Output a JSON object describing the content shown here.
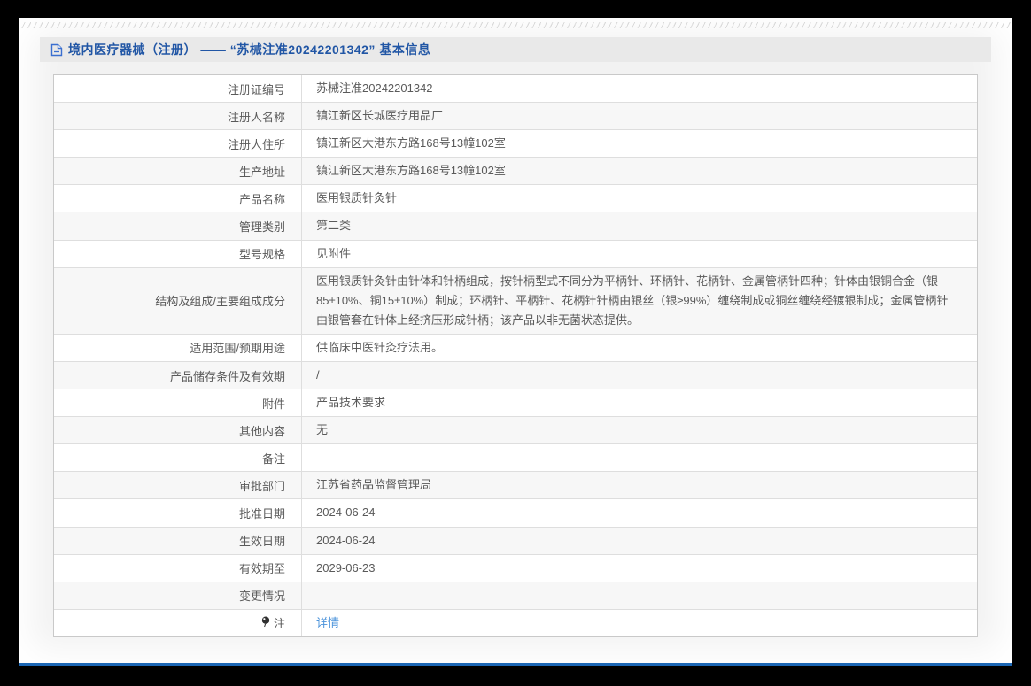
{
  "header": {
    "title": "境内医疗器械（注册） —— “苏械注准20242201342” 基本信息"
  },
  "colors": {
    "frame": "#000000",
    "accent_line": "#1b66b4",
    "title_text": "#2156a5",
    "link_text": "#4d94db"
  },
  "table": {
    "rows": [
      {
        "label": "注册证编号",
        "value": "苏械注准20242201342"
      },
      {
        "label": "注册人名称",
        "value": "镇江新区长城医疗用品厂"
      },
      {
        "label": "注册人住所",
        "value": "镇江新区大港东方路168号13幢102室"
      },
      {
        "label": "生产地址",
        "value": "镇江新区大港东方路168号13幢102室"
      },
      {
        "label": "产品名称",
        "value": "医用银质针灸针"
      },
      {
        "label": "管理类别",
        "value": "第二类"
      },
      {
        "label": "型号规格",
        "value": "见附件"
      },
      {
        "label": "结构及组成/主要组成成分",
        "value": "医用银质针灸针由针体和针柄组成，按针柄型式不同分为平柄针、环柄针、花柄针、金属管柄针四种；针体由银铜合金（银85±10%、铜15±10%）制成；环柄针、平柄针、花柄针针柄由银丝（银≥99%）缠绕制成或铜丝缠绕经镀银制成；金属管柄针由银管套在针体上经挤压形成针柄；该产品以非无菌状态提供。"
      },
      {
        "label": "适用范围/预期用途",
        "value": "供临床中医针灸疗法用。"
      },
      {
        "label": "产品储存条件及有效期",
        "value": "/"
      },
      {
        "label": "附件",
        "value": "产品技术要求"
      },
      {
        "label": "其他内容",
        "value": "无"
      },
      {
        "label": "备注",
        "value": ""
      },
      {
        "label": "审批部门",
        "value": "江苏省药品监督管理局"
      },
      {
        "label": "批准日期",
        "value": "2024-06-24"
      },
      {
        "label": "生效日期",
        "value": "2024-06-24"
      },
      {
        "label": "有效期至",
        "value": "2029-06-23"
      },
      {
        "label": "变更情况",
        "value": ""
      },
      {
        "label": "注",
        "value": "详情",
        "link": true,
        "label_icon": "balloon-icon"
      }
    ]
  }
}
